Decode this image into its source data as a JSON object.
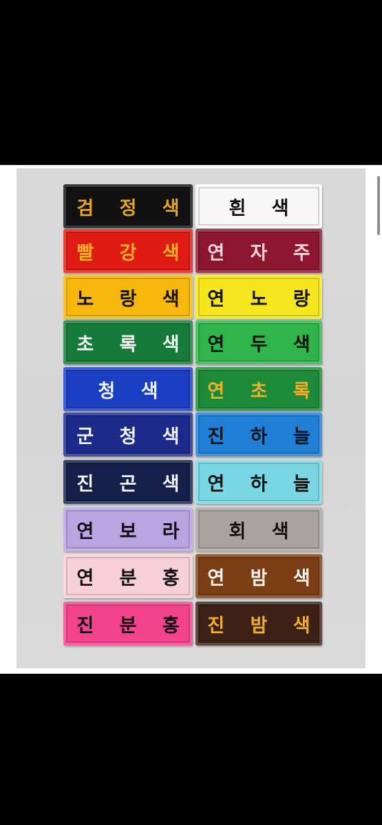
{
  "patches": [
    {
      "label": "검 정 색",
      "bg": "#111111",
      "fg": "#e8a321"
    },
    {
      "label": "흰   색",
      "bg": "#f7f7f7",
      "fg": "#111111"
    },
    {
      "label": "빨 강 색",
      "bg": "#e01b14",
      "fg": "#f2b02a"
    },
    {
      "label": "연 자 주",
      "bg": "#8c1630",
      "fg": "#f2d6dc"
    },
    {
      "label": "노 랑 색",
      "bg": "#f7b70c",
      "fg": "#111111"
    },
    {
      "label": "연 노 랑",
      "bg": "#f5e61d",
      "fg": "#111111"
    },
    {
      "label": "초 록 색",
      "bg": "#167b3a",
      "fg": "#f3f3f3"
    },
    {
      "label": "연 두 색",
      "bg": "#2fb54a",
      "fg": "#111111"
    },
    {
      "label": "청   색",
      "bg": "#1a3ec2",
      "fg": "#f3f3f3"
    },
    {
      "label": "연 초 록",
      "bg": "#1d8a39",
      "fg": "#f2b02a"
    },
    {
      "label": "군 청 색",
      "bg": "#1c2a8c",
      "fg": "#f3f3f3"
    },
    {
      "label": "진 하 늘",
      "bg": "#1f7fd6",
      "fg": "#111111"
    },
    {
      "label": "진 곤 색",
      "bg": "#14204a",
      "fg": "#f3f3f3"
    },
    {
      "label": "연 하 늘",
      "bg": "#79d7e3",
      "fg": "#111111"
    },
    {
      "label": "연 보 라",
      "bg": "#b7a4e0",
      "fg": "#111111"
    },
    {
      "label": "회   색",
      "bg": "#a8a39f",
      "fg": "#111111"
    },
    {
      "label": "연 분 홍",
      "bg": "#f7cfd8",
      "fg": "#111111"
    },
    {
      "label": "연 밤 색",
      "bg": "#7a3d14",
      "fg": "#f3f3f3"
    },
    {
      "label": "진 분 홍",
      "bg": "#f2438c",
      "fg": "#111111"
    },
    {
      "label": "진 밤 색",
      "bg": "#3d2116",
      "fg": "#f2b02a"
    }
  ]
}
